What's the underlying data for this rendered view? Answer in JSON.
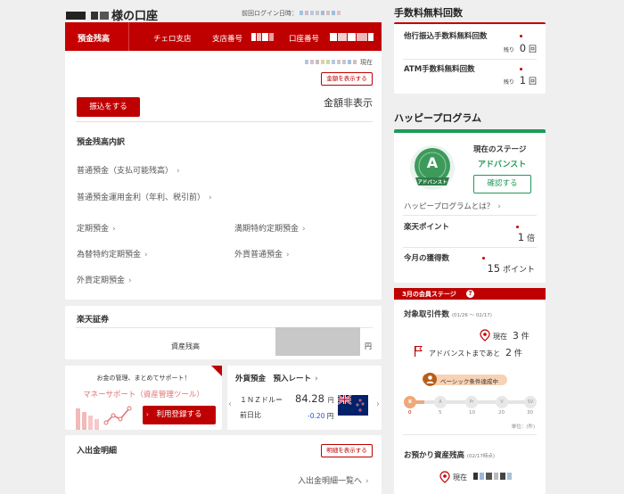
{
  "header": {
    "account_name_suffix": "様の口座",
    "last_login_label": "前回ログイン日時："
  },
  "account_tabs": {
    "balance_tab": "預金残高",
    "branch": "チェロ支店",
    "branch_no_label": "支店番号",
    "account_no_label": "口座番号"
  },
  "balance": {
    "as_of_suffix": "現在",
    "show_amount_button": "金額を表示する",
    "transfer_button": "振込をする",
    "hidden_text": "金額非表示",
    "breakdown_title": "預金残高内訳",
    "items": [
      "普通預金（支払可能残高）",
      "普通預金運用金利（年利、税引前）",
      "定期預金",
      "満期特約定期預金",
      "為替特約定期預金",
      "外貨普通預金",
      "外貨定期預金"
    ]
  },
  "securities": {
    "title": "楽天証券",
    "asset_label": "資産残高",
    "unit": "円"
  },
  "money_support": {
    "lead": "お金の管理、まとめてサポート！",
    "name": "マネーサポート（資産管理ツール）",
    "register_button": "利用登録する"
  },
  "fx": {
    "title": "外貨預金　預入レート",
    "pair": "１ＮＺドル＝",
    "rate": "84.28",
    "unit": "円",
    "change_label": "前日比",
    "change": "-0.20",
    "change_unit": "円"
  },
  "statement": {
    "title": "入出金明細",
    "show_button": "明細を表示する",
    "list_link": "入出金明細一覧へ"
  },
  "fee_free": {
    "title": "手数料無料回数",
    "rows": [
      {
        "label": "他行振込手数料無料回数",
        "remain_label": "残り",
        "value": "0",
        "unit": "回"
      },
      {
        "label": "ATM手数料無料回数",
        "remain_label": "残り",
        "value": "1",
        "unit": "回"
      }
    ]
  },
  "happy": {
    "title": "ハッピープログラム",
    "current_stage_label": "現在のステージ",
    "stage_name": "アドバンスト",
    "badge_letter": "A",
    "badge_label": "アドバンスト",
    "confirm_button": "確認する",
    "about_link": "ハッピープログラムとは？",
    "points_label": "楽天ポイント",
    "points_value": "1",
    "points_unit": "倍",
    "month_label": "今月の獲得数",
    "month_value": "15",
    "month_unit": "ポイント"
  },
  "member_stage": {
    "header": "3月の会員ステージ",
    "transactions_title": "対象取引件数",
    "period": "(01/26 ～ 02/17)",
    "current_label": "現在",
    "current_value": "3",
    "current_unit": "件",
    "to_advanced_label": "アドバンストまであと",
    "to_advanced_value": "2",
    "to_advanced_unit": "件",
    "achieved_label": "ベーシック条件達成中",
    "scale": [
      {
        "code": "B",
        "num": "0"
      },
      {
        "code": "A",
        "num": "5"
      },
      {
        "code": "Pr",
        "num": "10"
      },
      {
        "code": "V",
        "num": "20"
      },
      {
        "code": "SV",
        "num": "30"
      }
    ],
    "unit_note": "単位：(件)",
    "assets_title": "お預かり資産残高",
    "assets_period": "(02/17時点)",
    "assets_current_label": "現在"
  },
  "colors": {
    "brand_red": "#bf0000",
    "badge_green": "#3d9a5b",
    "stage_green": "#1f9a55",
    "fx_change": "#1a5ad6"
  }
}
